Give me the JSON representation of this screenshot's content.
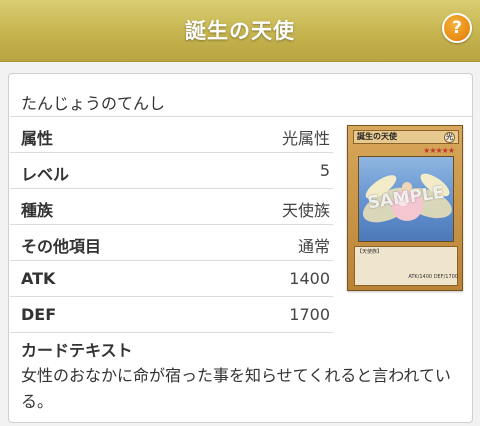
{
  "header": {
    "title": "誕生の天使",
    "help_label": "?"
  },
  "card_info": {
    "reading": "たんじょうのてんし",
    "rows": [
      {
        "label": "属性",
        "value": "光属性"
      },
      {
        "label": "レベル",
        "value": "5"
      },
      {
        "label": "種族",
        "value": "天使族"
      },
      {
        "label": "その他項目",
        "value": "通常"
      },
      {
        "label": "ATK",
        "value": "1400"
      },
      {
        "label": "DEF",
        "value": "1700"
      }
    ],
    "text_label": "カードテキスト",
    "text_body": "女性のおなかに命が宿った事を知らせてくれると言われている。"
  },
  "card_image": {
    "name": "誕生の天使",
    "attribute_glyph": "光",
    "stars": "★★★★★",
    "watermark": "SAMPLE",
    "type_line": "【天使族】",
    "stats": "ATK/1400 DEF/1700"
  },
  "colors": {
    "header_gold": "#c6b44f",
    "help_orange": "#e78a12",
    "panel_bg": "#ffffff",
    "page_bg": "#f2f2f2"
  },
  "icons": {
    "help": "question-mark-icon"
  }
}
